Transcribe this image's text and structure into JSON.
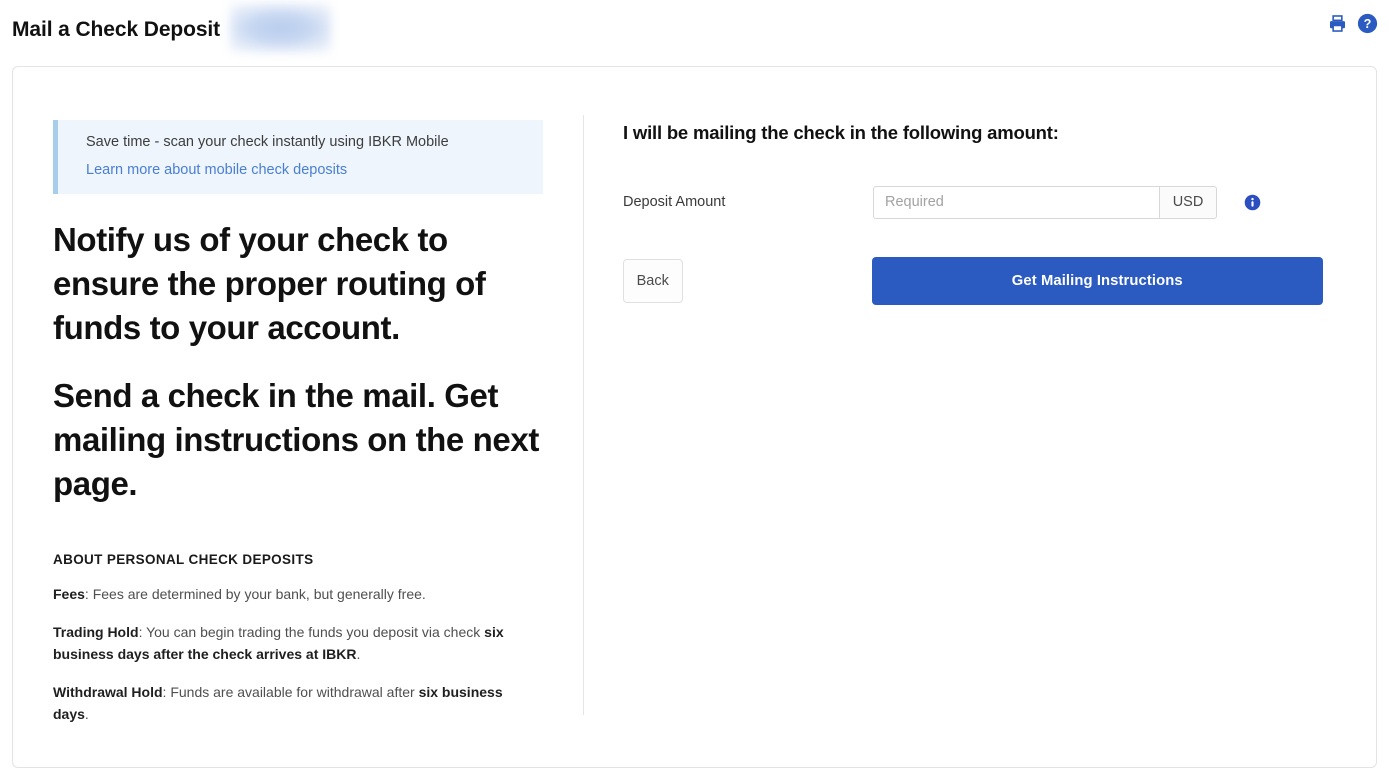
{
  "header": {
    "title": "Mail a Check Deposit",
    "redacted_label": "",
    "print_icon": "printer-icon",
    "help_icon": "question-mark-icon"
  },
  "notice": {
    "text": "Save time - scan your check instantly using IBKR Mobile",
    "link": "Learn more about mobile check deposits"
  },
  "headlines": {
    "first": "Notify us of your check to ensure the proper routing of funds to your account.",
    "second": "Send a check in the mail. Get mailing instructions on the next page."
  },
  "about": {
    "title": "ABOUT PERSONAL CHECK DEPOSITS",
    "items": [
      {
        "term": "Fees",
        "sep": ": ",
        "text_plain": "Fees are determined by your bank, but generally free.",
        "text_bold": "",
        "text_tail": ""
      },
      {
        "term": "Trading Hold",
        "sep": ": ",
        "text_plain": "You can begin trading the funds you deposit via check ",
        "text_bold": "six business days after the check arrives at IBKR",
        "text_tail": "."
      },
      {
        "term": "Withdrawal Hold",
        "sep": ": ",
        "text_plain": "Funds are available for withdrawal after ",
        "text_bold": "six business days",
        "text_tail": "."
      }
    ]
  },
  "form": {
    "heading": "I will be mailing the check in the following amount:",
    "amount_label": "Deposit Amount",
    "amount_value": "",
    "amount_placeholder": "Required",
    "currency": "USD",
    "info_icon": "info-circle-icon",
    "back_label": "Back",
    "submit_label": "Get Mailing Instructions"
  },
  "colors": {
    "primary": "#2b5bc0",
    "link": "#4a7fd4",
    "notice_bg": "#eef5fc",
    "notice_accent": "#a8cdeb",
    "border": "#e3e3e3"
  }
}
